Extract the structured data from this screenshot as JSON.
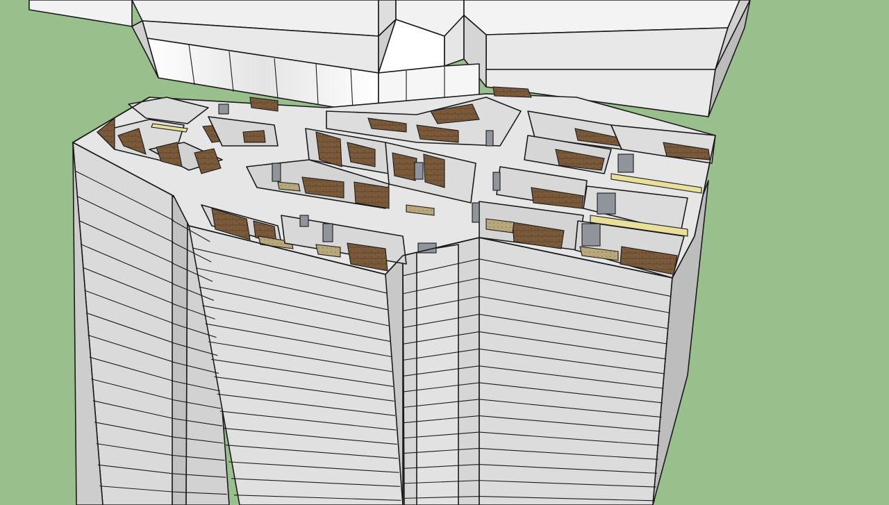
{
  "scene": {
    "colors": {
      "ground": "#98bf8c",
      "facade_light": "#dcdcdc",
      "facade_mid": "#c9c9c9",
      "facade_dark": "#b4b4b4",
      "roof_white": "#f4f4f4",
      "wall_inner": "#d8d8d8",
      "brick_wood": "#7a5a3a",
      "floor_tile": "#b8a77a",
      "glass": "#f2f2f2",
      "door": "#8f959a",
      "yellow_strip": "#e8df9a",
      "edge": "#1a1a1a"
    },
    "floor_count": 17
  }
}
